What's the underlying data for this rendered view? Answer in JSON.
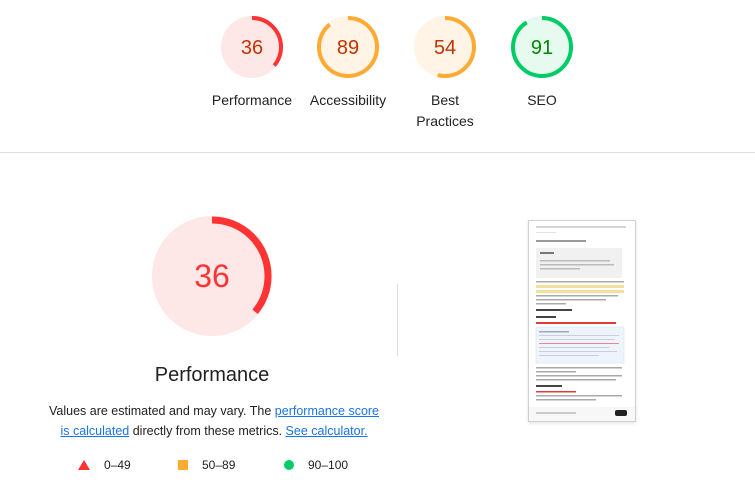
{
  "gauges": [
    {
      "score": "36",
      "label_lines": [
        "Performance"
      ],
      "color": "#ff3333",
      "bg": "#fde7e7",
      "text_color": "#c33300",
      "value": 36
    },
    {
      "score": "89",
      "label_lines": [
        "Accessibility"
      ],
      "color": "#ffaa33",
      "bg": "#fff4e5",
      "text_color": "#c33300",
      "value": 89
    },
    {
      "score": "54",
      "label_lines": [
        "Best",
        "Practices"
      ],
      "color": "#ffaa33",
      "bg": "#fff4e5",
      "text_color": "#c33300",
      "value": 54
    },
    {
      "score": "91",
      "label_lines": [
        "SEO"
      ],
      "color": "#00cc66",
      "bg": "#e6faf0",
      "text_color": "#008800",
      "value": 91
    }
  ],
  "main": {
    "score": "36",
    "value": 36,
    "title": "Performance",
    "desc_pre": "Values are estimated and may vary. The ",
    "desc_link1": "performance score is calculated",
    "desc_mid": " directly from these metrics. ",
    "desc_link2": "See calculator."
  },
  "legend": {
    "fail": "0–49",
    "average": "50–89",
    "pass": "90–100"
  },
  "colors": {
    "fail": "#ff3333",
    "average": "#ffaa33",
    "pass": "#00cc66"
  }
}
